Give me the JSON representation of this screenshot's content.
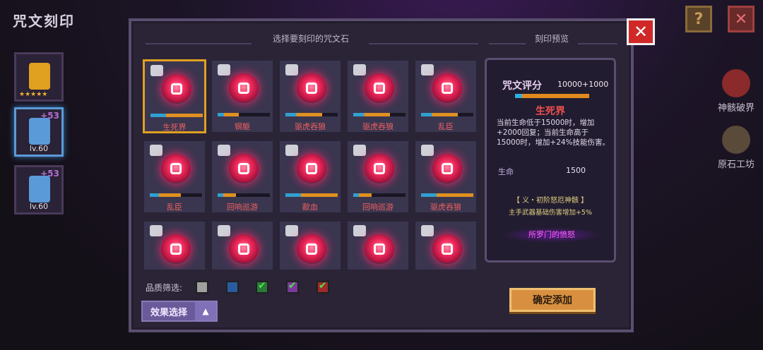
{
  "header": {
    "title": "咒文刻印",
    "help_label": "?",
    "close_label": "✕"
  },
  "side_items": [
    {
      "level": "",
      "plus": "",
      "stars": "★★★★★",
      "color": "#e0a020"
    },
    {
      "level": "lv.60",
      "plus": "+53",
      "stars": "",
      "color": "#5a9ad8"
    },
    {
      "level": "lv.60",
      "plus": "+53",
      "stars": "",
      "color": "#5a9ad8"
    }
  ],
  "right_icons": [
    {
      "label": "神骸破界"
    },
    {
      "label": "原石工坊"
    }
  ],
  "panel": {
    "close_label": "✕",
    "select_header": "选择要刻印的咒文石",
    "preview_header": "刻印预览"
  },
  "cards": [
    {
      "name": "生死界",
      "selected": true
    },
    {
      "name": "钢躯"
    },
    {
      "name": "驱虎吞狼"
    },
    {
      "name": "驱虎吞狼"
    },
    {
      "name": "乱臣"
    },
    {
      "name": "乱臣"
    },
    {
      "name": "回响巡游"
    },
    {
      "name": "歃血"
    },
    {
      "name": "回响巡游"
    },
    {
      "name": "驱虎吞狼"
    },
    {
      "name": ""
    },
    {
      "name": ""
    },
    {
      "name": ""
    },
    {
      "name": ""
    },
    {
      "name": ""
    }
  ],
  "preview": {
    "score_label": "咒文评分",
    "score_value": "10000+1000",
    "name": "生死界",
    "description": "当前生命低于15000时，增加+2000回复；当前生命高于15000时，增加+24%技能伤害。",
    "stat_label": "生命",
    "stat_value": "1500",
    "set_name": "【 义・初阶怒厄神骸 】",
    "set_desc": "主手武器基础伤害增加+5%",
    "set_button": "所罗门的愤怒"
  },
  "filter": {
    "label": "品质筛选:",
    "checks": [
      {
        "color": "#a0a0a0",
        "checked": false
      },
      {
        "color": "#2a5aa0",
        "checked": false
      },
      {
        "color": "#2a7a3a",
        "checked": true
      },
      {
        "color": "#7a3a9a",
        "checked": true
      },
      {
        "color": "#a02a2a",
        "checked": true
      }
    ]
  },
  "effect_button": {
    "label": "效果选择",
    "arrow": "▲"
  },
  "confirm_button": {
    "label": "确定添加"
  }
}
